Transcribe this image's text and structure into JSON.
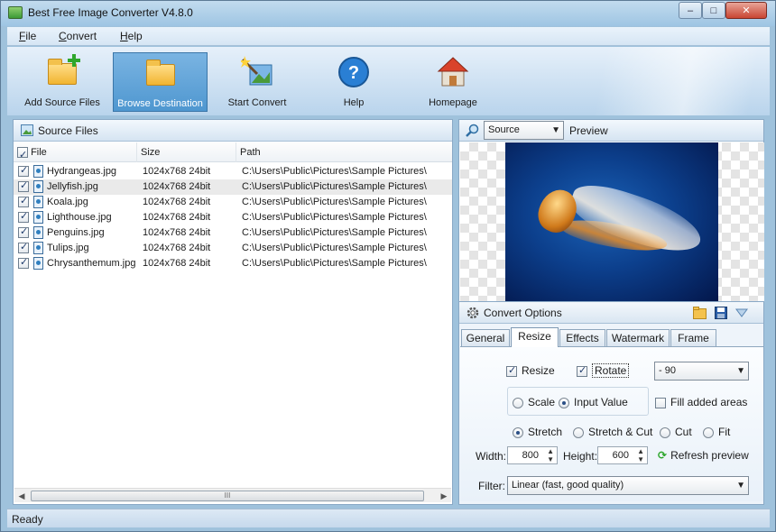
{
  "window": {
    "title": "Best Free Image Converter V4.8.0",
    "controls": {
      "minimize": "–",
      "maximize": "□",
      "close": "✕"
    }
  },
  "menu": [
    "File",
    "Convert",
    "Help"
  ],
  "toolbar": [
    {
      "label": "Add Source Files",
      "icon": "add-folder-icon"
    },
    {
      "label": "Browse Destination",
      "icon": "folder-icon"
    },
    {
      "label": "Start Convert",
      "icon": "magic-wand-icon"
    },
    {
      "label": "Help",
      "icon": "help-icon"
    },
    {
      "label": "Homepage",
      "icon": "home-icon"
    }
  ],
  "source_panel": {
    "title": "Source Files",
    "columns": [
      "File",
      "Size",
      "Path"
    ],
    "rows": [
      {
        "file": "Hydrangeas.jpg",
        "size": "1024x768  24bit",
        "path": "C:\\Users\\Public\\Pictures\\Sample Pictures\\",
        "checked": true
      },
      {
        "file": "Jellyfish.jpg",
        "size": "1024x768  24bit",
        "path": "C:\\Users\\Public\\Pictures\\Sample Pictures\\",
        "checked": true
      },
      {
        "file": "Koala.jpg",
        "size": "1024x768  24bit",
        "path": "C:\\Users\\Public\\Pictures\\Sample Pictures\\",
        "checked": true
      },
      {
        "file": "Lighthouse.jpg",
        "size": "1024x768  24bit",
        "path": "C:\\Users\\Public\\Pictures\\Sample Pictures\\",
        "checked": true
      },
      {
        "file": "Penguins.jpg",
        "size": "1024x768  24bit",
        "path": "C:\\Users\\Public\\Pictures\\Sample Pictures\\",
        "checked": true
      },
      {
        "file": "Tulips.jpg",
        "size": "1024x768  24bit",
        "path": "C:\\Users\\Public\\Pictures\\Sample Pictures\\",
        "checked": true
      },
      {
        "file": "Chrysanthemum.jpg",
        "size": "1024x768  24bit",
        "path": "C:\\Users\\Public\\Pictures\\Sample Pictures\\",
        "checked": true
      }
    ],
    "scroll_thumb": "III"
  },
  "preview": {
    "source_select": "Source",
    "title": "Preview"
  },
  "convert_options": {
    "title": "Convert Options",
    "tabs": [
      "General",
      "Resize",
      "Effects",
      "Watermark",
      "Frame"
    ],
    "active_tab": "Resize",
    "resize_label": "Resize",
    "rotate_label": "Rotate",
    "rotate_value": "- 90",
    "scale_label": "Scale",
    "input_value_label": "Input Value",
    "fill_label": "Fill added areas",
    "modes": [
      "Stretch",
      "Stretch & Cut",
      "Cut",
      "Fit"
    ],
    "width_label": "Width:",
    "width_value": "800",
    "height_label": "Height:",
    "height_value": "600",
    "refresh_label": "Refresh preview",
    "filter_label": "Filter:",
    "filter_value": "Linear (fast, good quality)"
  },
  "status": "Ready"
}
